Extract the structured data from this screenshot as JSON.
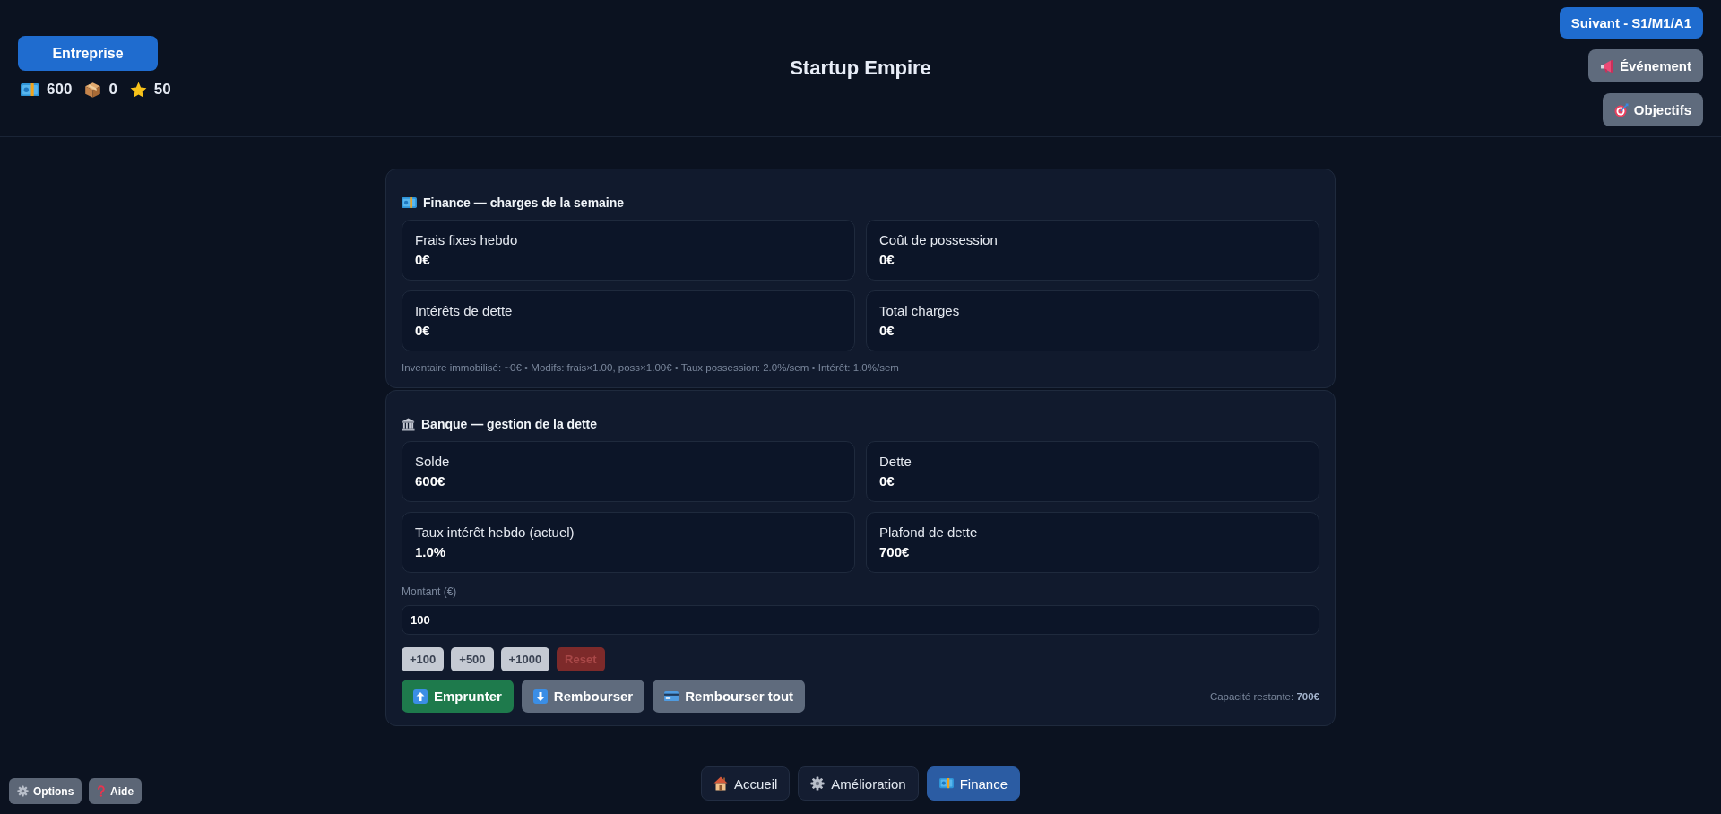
{
  "header": {
    "company_button": "Entreprise",
    "stats": [
      "600",
      "0",
      "50"
    ],
    "title": "Startup Empire",
    "next_button": "Suivant - S1/M1/A1",
    "buttons": [
      "Événement",
      "Objectifs"
    ]
  },
  "finance": {
    "title": "Finance — charges de la semaine",
    "metrics": [
      {
        "label": "Frais fixes hebdo",
        "value": "0€"
      },
      {
        "label": "Coût de possession",
        "value": "0€"
      },
      {
        "label": "Intérêts de dette",
        "value": "0€"
      },
      {
        "label": "Total charges",
        "value": "0€"
      }
    ],
    "note": "Inventaire immobilisé: ~0€ • Modifs: frais×1.00, poss×1.00€ • Taux possession: 2.0%/sem • Intérêt: 1.0%/sem"
  },
  "bank": {
    "title": "Banque — gestion de la dette",
    "metrics": [
      {
        "label": "Solde",
        "value": "600€"
      },
      {
        "label": "Dette",
        "value": "0€"
      },
      {
        "label": "Taux intérêt hebdo (actuel)",
        "value": "1.0%"
      },
      {
        "label": "Plafond de dette",
        "value": "700€"
      }
    ],
    "amount": {
      "label": "Montant (€)",
      "value": "100"
    },
    "quick_buttons": [
      {
        "label": "+100",
        "kind": "add"
      },
      {
        "label": "+500",
        "kind": "add"
      },
      {
        "label": "+1000",
        "kind": "add"
      },
      {
        "label": "Reset",
        "kind": "reset"
      }
    ],
    "actions": [
      {
        "label": "Emprunter",
        "kind": "primary"
      },
      {
        "label": "Rembourser",
        "kind": "secondary"
      },
      {
        "label": "Rembourser tout",
        "kind": "secondary"
      }
    ],
    "capacity": "Capacité restante: **700€**"
  },
  "nav": {
    "tabs": [
      {
        "label": "Accueil",
        "selected": false
      },
      {
        "label": "Amélioration",
        "selected": false
      },
      {
        "label": "Finance",
        "selected": true
      }
    ]
  },
  "corner_buttons": [
    "Options",
    "Aide"
  ]
}
